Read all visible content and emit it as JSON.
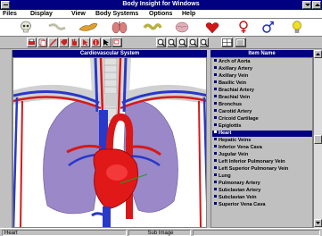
{
  "window": {
    "title": "Body Insight for Windows"
  },
  "menu": [
    "Files",
    "Display",
    "View",
    "Body Systems",
    "Options",
    "Help"
  ],
  "icons": [
    "skull-icon",
    "spine-icon",
    "muscle-arm-icon",
    "lungs-icon",
    "intestine-icon",
    "brain-icon",
    "heart-icon",
    "female-symbol-icon",
    "male-symbol-icon",
    "lightbulb-icon"
  ],
  "toolbar": {
    "zoom_tooltip": "Zoom"
  },
  "image_pane": {
    "title": "Cardiovascular System"
  },
  "list_pane": {
    "title": "Item Name",
    "items": [
      "Arch of Aorta",
      "Axillary Artery",
      "Axillary Vein",
      "Basilic Vein",
      "Brachial Artery",
      "Brachial Vein",
      "Bronchus",
      "Carotid Artery",
      "Cricoid Cartilage",
      "Epiglottis",
      "Heart",
      "Hepatic Veins",
      "Inferior Vena Cava",
      "Jugular Vein",
      "Left Inferior Pulmonary Vein",
      "Left Superior Pulmonary Vein",
      "Lung",
      "Pulmonary Artery",
      "Subclavian Artery",
      "Subclavian Vein",
      "Superior Vena Cava"
    ],
    "selected": "Heart"
  },
  "status": {
    "left": "Heart",
    "middle": "Sub Image"
  },
  "colors": {
    "titlebar": "#000080",
    "selection": "#000080",
    "artery": "#d81818",
    "vein": "#2838c8",
    "lung": "#9a88c8"
  }
}
